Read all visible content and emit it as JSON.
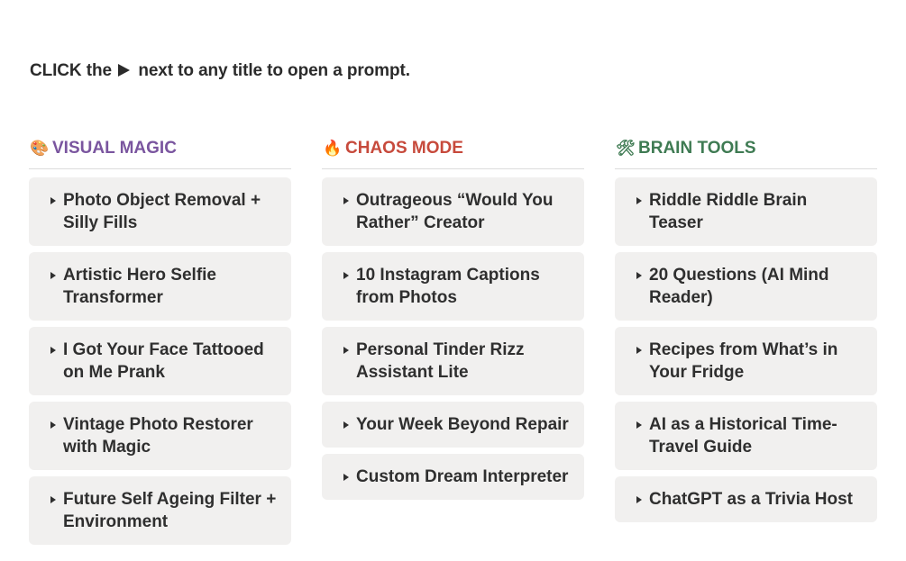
{
  "instruction": {
    "before": "CLICK the",
    "after": "next to any title to open a prompt."
  },
  "colors": {
    "visual_magic": "#7a559f",
    "chaos_mode": "#c74a3c",
    "brain_tools": "#3f7b53",
    "card_bg": "#f1f0ef"
  },
  "columns": [
    {
      "emoji": "🎨",
      "emoji_name": "palette-icon",
      "title": "VISUAL MAGIC",
      "items": [
        "Photo Object Removal + Silly Fills",
        "Artistic Hero Selfie Transformer",
        "I Got Your Face Tattooed on Me Prank",
        "Vintage Photo Restorer with Magic",
        "Future Self Ageing Filter + Environment"
      ]
    },
    {
      "emoji": "🔥",
      "emoji_name": "fire-icon",
      "title": "CHAOS MODE",
      "items": [
        "Outrageous “Would You Rather” Creator",
        "10 Instagram Captions from Photos",
        "Personal Tinder Rizz Assistant Lite",
        "Your Week Beyond Repair",
        "Custom Dream Interpreter"
      ]
    },
    {
      "emoji": "🛠",
      "emoji_name": "tools-icon",
      "title": "BRAIN TOOLS",
      "items": [
        "Riddle Riddle Brain Teaser",
        "20 Questions (AI Mind Reader)",
        "Recipes from What’s in Your Fridge",
        "AI as a Historical Time-Travel Guide",
        "ChatGPT as a Trivia Host"
      ]
    }
  ]
}
